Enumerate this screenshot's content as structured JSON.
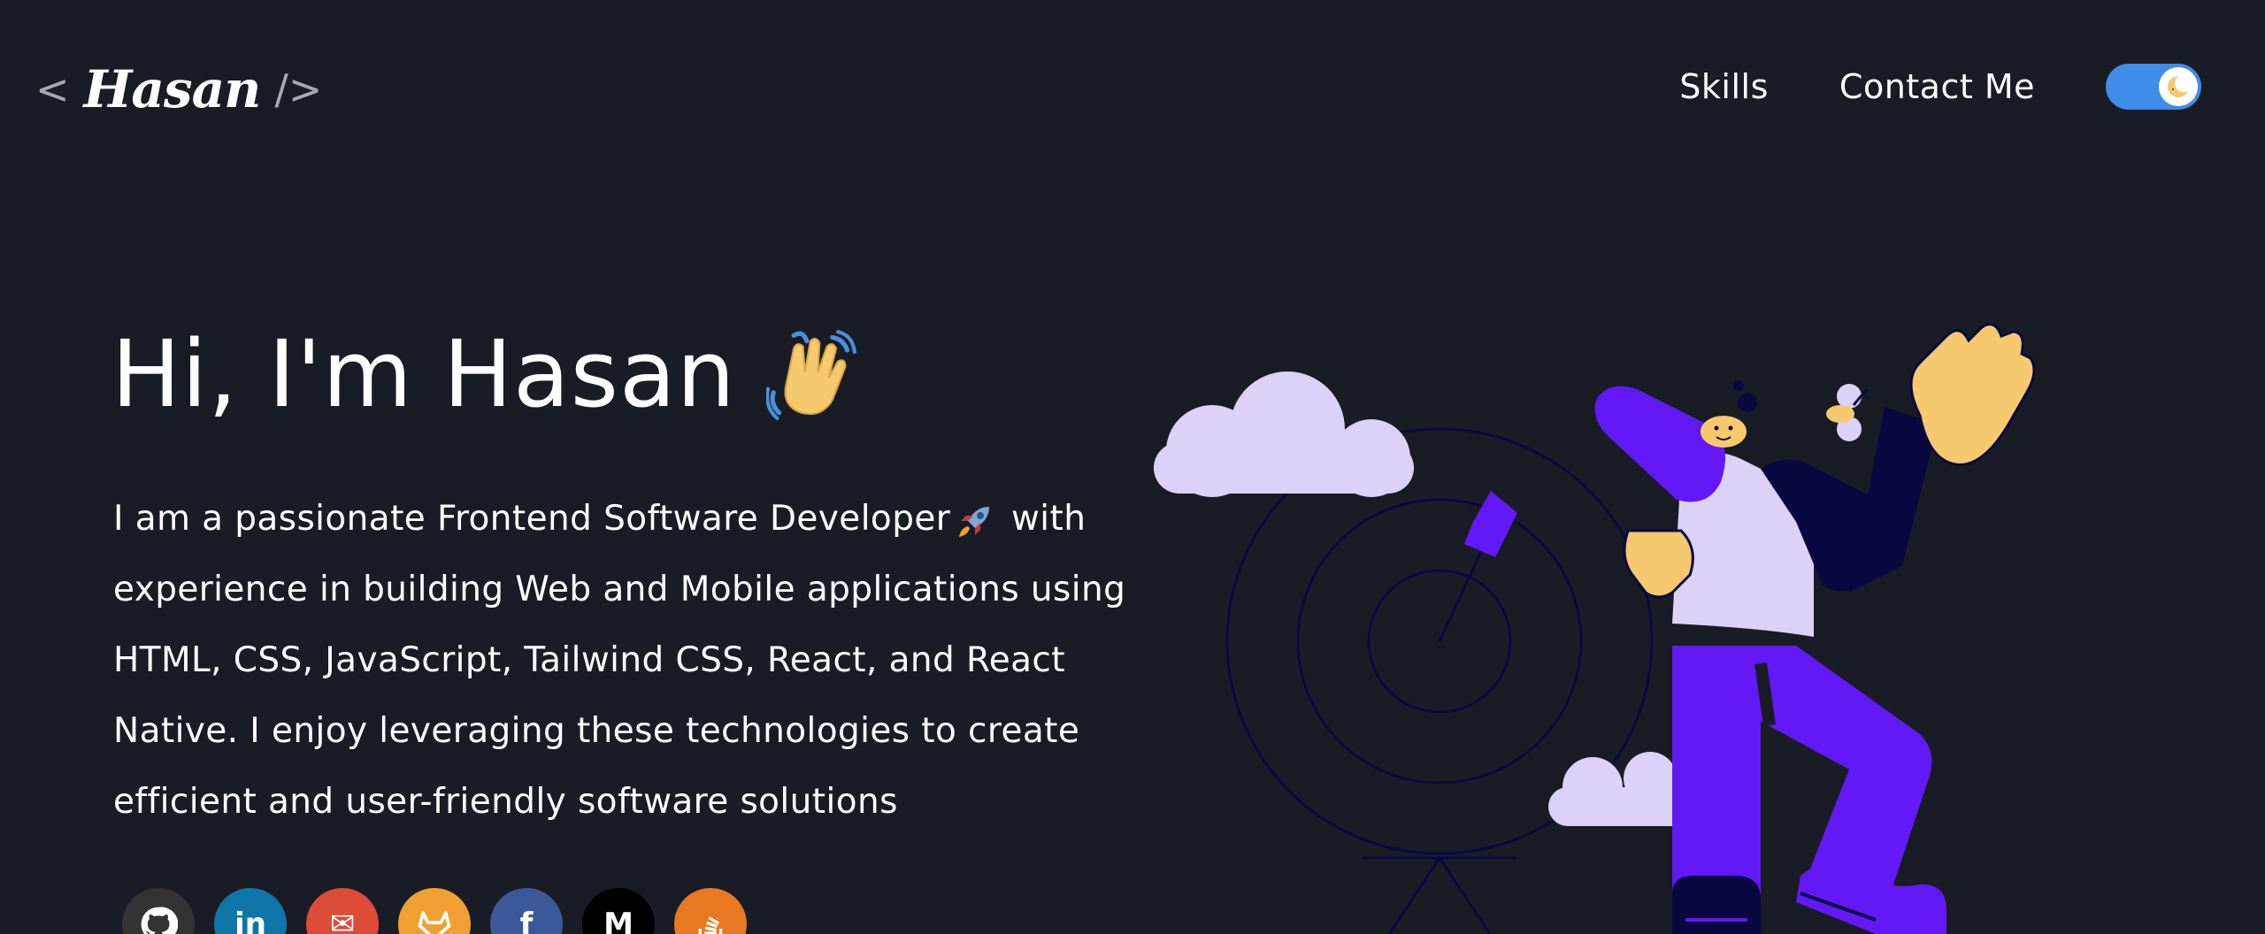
{
  "header": {
    "logo": {
      "open": "<",
      "name": "Hasan",
      "close": "/>"
    },
    "nav": [
      {
        "label": "Skills"
      },
      {
        "label": "Contact Me"
      }
    ],
    "theme_toggle": {
      "icon": "moon-icon",
      "state": "dark",
      "accent": "#3f8ceb"
    }
  },
  "hero": {
    "greeting": "Hi, I'm Hasan",
    "greeting_icon": "waving-hand-icon",
    "intro_part1": "I am a passionate Frontend Software Developer",
    "intro_icon": "rocket-icon",
    "intro_part2": "with experience in building Web and Mobile applications using HTML, CSS, JavaScript, Tailwind CSS, React, and React Native. I enjoy leveraging these technologies to create efficient and user-friendly software solutions"
  },
  "social": [
    {
      "icon": "github-icon",
      "color": "#333333",
      "glyph": ""
    },
    {
      "icon": "linkedin-icon",
      "color": "#0e76a8",
      "glyph": "in"
    },
    {
      "icon": "gmail-icon",
      "color": "#dd4b39",
      "glyph": "✉"
    },
    {
      "icon": "gitlab-icon",
      "color": "#f0a030",
      "glyph": ""
    },
    {
      "icon": "facebook-icon",
      "color": "#3b5998",
      "glyph": "f"
    },
    {
      "icon": "medium-icon",
      "color": "#000000",
      "glyph": "M"
    },
    {
      "icon": "stackoverflow-icon",
      "color": "#e87922",
      "glyph": ""
    }
  ],
  "colors": {
    "background": "#1a1c25",
    "illustration_purple": "#6219f5",
    "illustration_lavender": "#dcd1f7",
    "illustration_yellow": "#f6c96e",
    "illustration_navy": "#0b0740"
  }
}
